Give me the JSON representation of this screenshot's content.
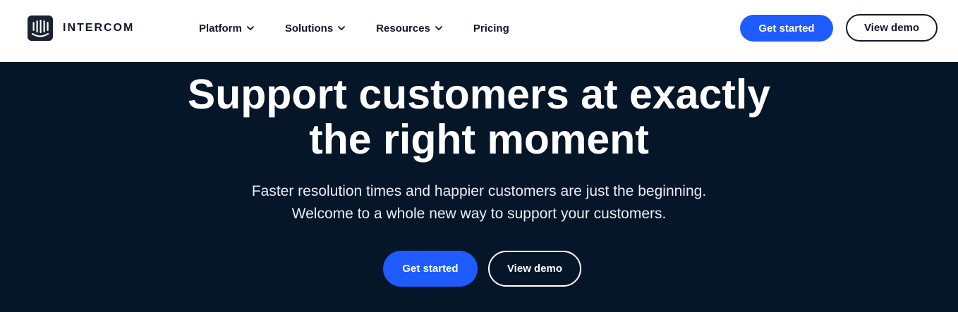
{
  "brand": {
    "name": "INTERCOM",
    "logo_icon": "intercom-logo-icon"
  },
  "nav": {
    "items": [
      {
        "label": "Platform",
        "has_dropdown": true
      },
      {
        "label": "Solutions",
        "has_dropdown": true
      },
      {
        "label": "Resources",
        "has_dropdown": true
      },
      {
        "label": "Pricing",
        "has_dropdown": false
      }
    ]
  },
  "header_actions": {
    "get_started": "Get started",
    "view_demo": "View demo"
  },
  "hero": {
    "headline_line1": "Support customers at exactly",
    "headline_line2": "the right moment",
    "sub_line1": "Faster resolution times and happier customers are just the beginning.",
    "sub_line2": "Welcome to a whole new way to support your customers.",
    "get_started": "Get started",
    "view_demo": "View demo"
  },
  "colors": {
    "primary": "#1f5cff",
    "hero_bg": "#051629",
    "header_bg": "#ffffff"
  }
}
